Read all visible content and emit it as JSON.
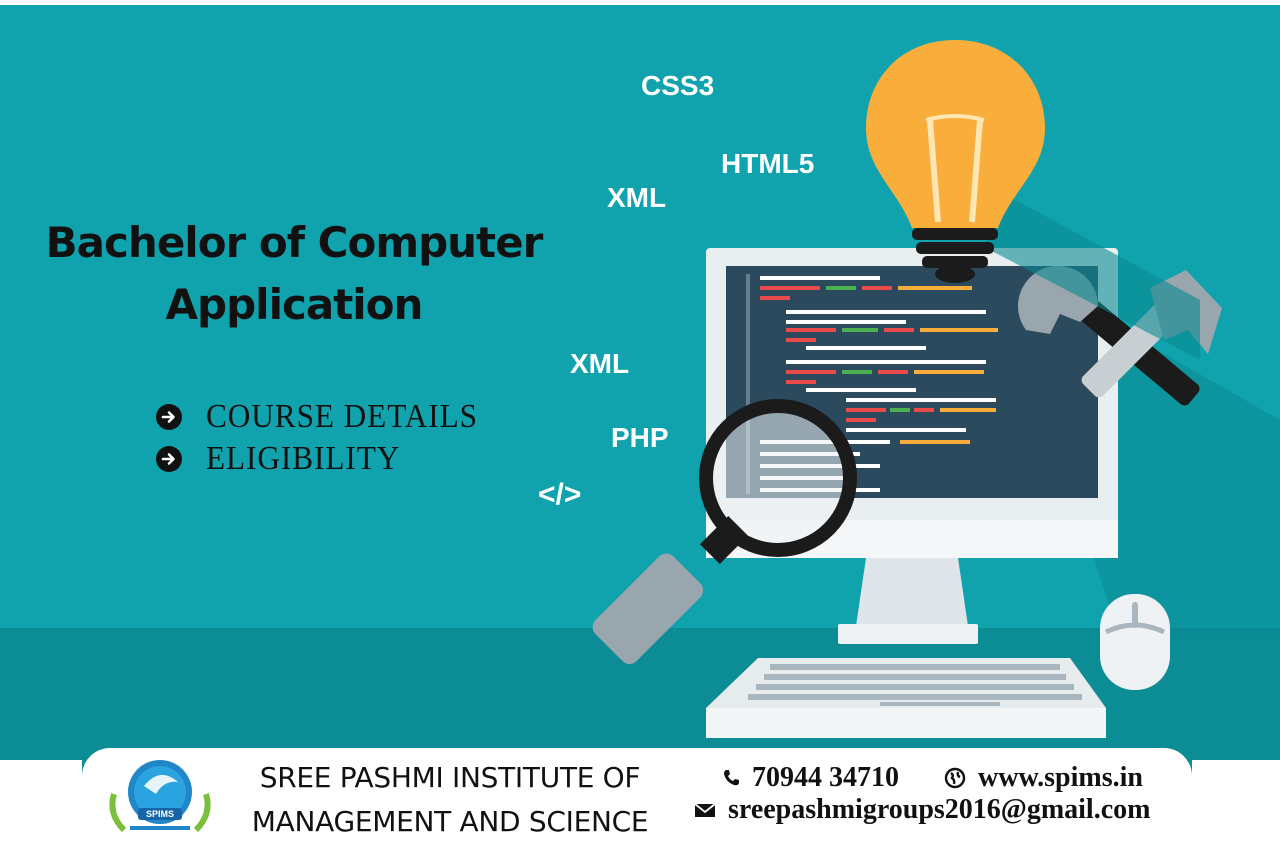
{
  "title": {
    "line1": "Bachelor of Computer",
    "line2": "Application"
  },
  "menu": {
    "items": [
      {
        "label": "COURSE DETAILS",
        "icon": "arrow-circle-right-icon"
      },
      {
        "label": "ELIGIBILITY",
        "icon": "arrow-circle-right-icon"
      }
    ]
  },
  "tech_labels": {
    "css": "CSS3",
    "html": "HTML5",
    "xml_top": "XML",
    "xml_bottom": "XML",
    "php": "PHP",
    "code_tag": "</>"
  },
  "footer": {
    "institute_line1": "SREE PASHMI INSTITUTE OF",
    "institute_line2": "MANAGEMENT AND SCIENCE",
    "logo_text": "SPIMS",
    "phone": "70944 34710",
    "website": "www.spims.in",
    "email": "sreepashmigroups2016@gmail.com"
  },
  "colors": {
    "background": "#10a3ad",
    "background_band": "#0c8d96",
    "bulb": "#f9ae3c",
    "screen": "#2c4a5e",
    "text_dark": "#111111"
  }
}
